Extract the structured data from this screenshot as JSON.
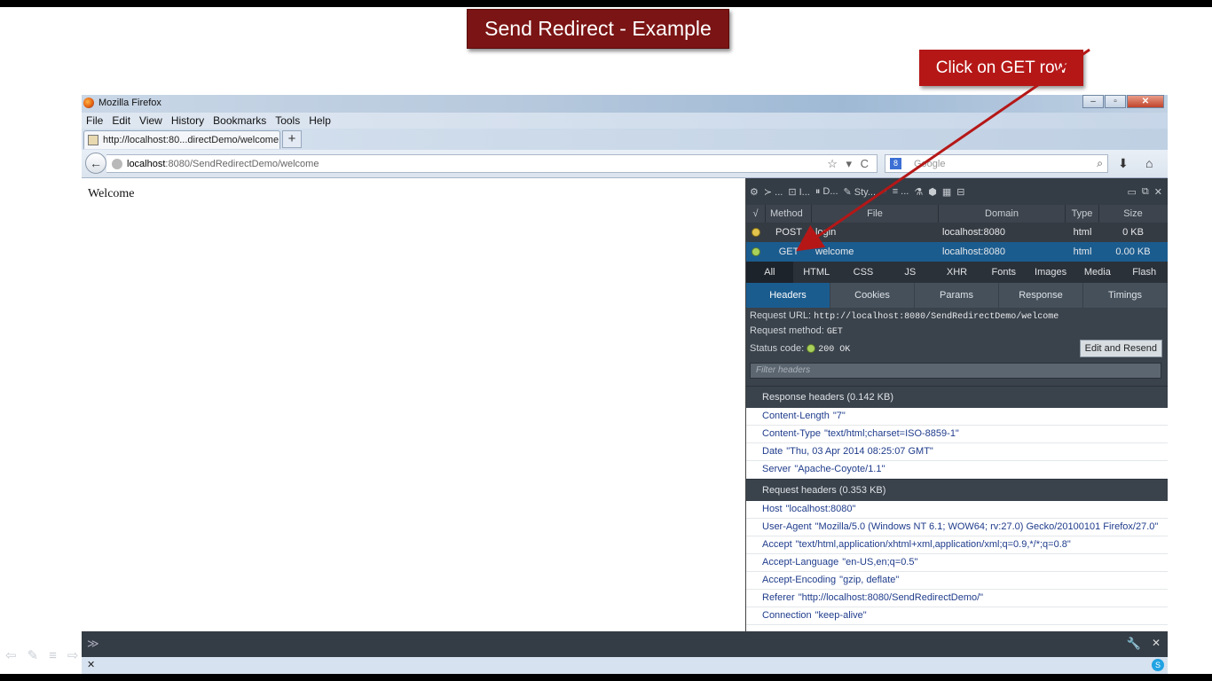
{
  "slide": {
    "title": "Send Redirect - Example",
    "callout": "Click on GET row",
    "colors": {
      "title_bg": "#7b1414",
      "callout_bg": "#b51717",
      "arrow": "#b51717"
    }
  },
  "window": {
    "title": "Mozilla Firefox",
    "controls": {
      "minimize": "–",
      "maximize": "▫",
      "close": "✕"
    }
  },
  "menu": [
    "File",
    "Edit",
    "View",
    "History",
    "Bookmarks",
    "Tools",
    "Help"
  ],
  "tab": {
    "label": "http://localhost:80...directDemo/welcome",
    "new_tab": "+"
  },
  "nav": {
    "back": "←",
    "url_host": "localhost",
    "url_rest": ":8080/SendRedirectDemo/welcome",
    "url_icons": "☆ ▾ C",
    "search_placeholder": "Google",
    "search_engine": "8",
    "search_icon": "⌕",
    "download_icon": "⬇",
    "home_icon": "⌂"
  },
  "page": {
    "welcome": "Welcome"
  },
  "devtools": {
    "toolbar": [
      "⚙",
      "≻ ...",
      "⊡ I...",
      "⏸ D...",
      "✎ Sty...",
      "◔",
      "≡ ...",
      "⚗",
      "⬢",
      "▦",
      "⊟"
    ],
    "toolbar_right": [
      "▭",
      "⧉",
      "✕"
    ],
    "columns": [
      "√",
      "Method",
      "File",
      "Domain",
      "Type",
      "Size"
    ],
    "rows": [
      {
        "method": "POST",
        "file": "login",
        "domain": "localhost:8080",
        "type": "html",
        "size": "0 KB"
      },
      {
        "method": "GET",
        "file": "welcome",
        "domain": "localhost:8080",
        "type": "html",
        "size": "0.00 KB"
      }
    ],
    "filters": [
      "All",
      "HTML",
      "CSS",
      "JS",
      "XHR",
      "Fonts",
      "Images",
      "Media",
      "Flash"
    ],
    "subtabs": [
      "Headers",
      "Cookies",
      "Params",
      "Response",
      "Timings"
    ],
    "summary": {
      "url_label": "Request URL:",
      "url_value": "http://localhost:8080/SendRedirectDemo/welcome",
      "method_label": "Request method:",
      "method_value": "GET",
      "status_label": "Status code:",
      "status_value": "200 OK",
      "resend": "Edit and Resend",
      "filter_placeholder": "Filter headers"
    },
    "response_title": "Response headers (0.142 KB)",
    "response_headers": [
      {
        "name": "Content-Length",
        "value": "\"7\""
      },
      {
        "name": "Content-Type",
        "value": "\"text/html;charset=ISO-8859-1\""
      },
      {
        "name": "Date",
        "value": "\"Thu, 03 Apr 2014 08:25:07 GMT\""
      },
      {
        "name": "Server",
        "value": "\"Apache-Coyote/1.1\""
      }
    ],
    "request_title": "Request headers (0.353 KB)",
    "request_headers": [
      {
        "name": "Host",
        "value": "\"localhost:8080\""
      },
      {
        "name": "User-Agent",
        "value": "\"Mozilla/5.0 (Windows NT 6.1; WOW64; rv:27.0) Gecko/20100101 Firefox/27.0\""
      },
      {
        "name": "Accept",
        "value": "\"text/html,application/xhtml+xml,application/xml;q=0.9,*/*;q=0.8\""
      },
      {
        "name": "Accept-Language",
        "value": "\"en-US,en;q=0.5\""
      },
      {
        "name": "Accept-Encoding",
        "value": "\"gzip, deflate\""
      },
      {
        "name": "Referer",
        "value": "\"http://localhost:8080/SendRedirectDemo/\""
      },
      {
        "name": "Connection",
        "value": "\"keep-alive\""
      }
    ]
  },
  "console": {
    "chevron": "≫",
    "wrench": "🔧",
    "close": "✕"
  },
  "addon_bar": {
    "close": "✕",
    "skype": "S"
  }
}
